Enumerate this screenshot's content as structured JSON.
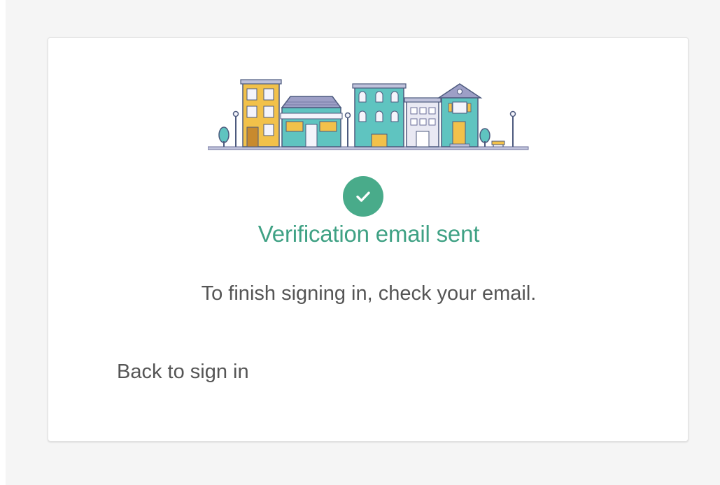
{
  "card": {
    "illustration": "street-of-houses-illustration",
    "status_icon": "check-circle-icon",
    "title": "Verification email sent",
    "message": "To finish signing in, check your email.",
    "back_link": "Back to sign in"
  },
  "colors": {
    "accent": "#49ab8a",
    "title_text": "#3fa184",
    "body_text": "#555555",
    "background": "#f5f5f5",
    "card": "#ffffff"
  }
}
